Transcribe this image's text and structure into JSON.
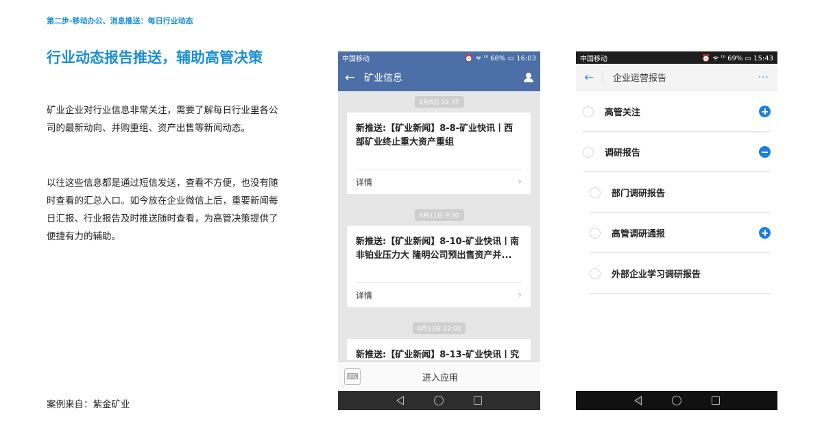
{
  "step_label": "第二步-移动办公、消息推送：每日行业动态",
  "headline": "行业动态报告推送，辅助高管决策",
  "paragraphs": [
    "矿业企业对行业信息非常关注，需要了解每日行业里各公司的最新动向、并购重组、资产出售等新闻动态。",
    "以往这些信息都是通过短信发送，查看不方便，也没有随时查看的汇总入口。如今放在企业微信上后，重要新闻每日汇报、行业报告及时推送随时查看，为高管决策提供了便捷有力的辅助。"
  ],
  "source": "案例来自：紫金矿业",
  "phone_a": {
    "status": {
      "carrier": "中国移动",
      "right": "⏰ ᯤ ᵗˡˡ 68% ▭ 16:03"
    },
    "header_title": "矿业信息",
    "messages": [
      {
        "time": "8月8日 22:37",
        "title": "新推送:【矿业新闻】8-8-矿业快讯丨西部矿业终止重大资产重组",
        "foot": "详情"
      },
      {
        "time": "8月11日 9:30",
        "title": "新推送:【矿业新闻】8-10-矿业快讯丨南非铂业压力大 隆明公司预出售资产并...",
        "foot": "详情"
      },
      {
        "time": "8月13日 22:02",
        "title": "新推送:【矿业新闻】8-13-矿业快讯丨究"
      }
    ],
    "bottom_label": "进入应用"
  },
  "phone_b": {
    "status": {
      "carrier": "中国移动",
      "right": "⏰ ᯤ ᵗˡˡ 69% ▭ 15:43"
    },
    "header_title": "企业运营报告",
    "more_label": "···",
    "items": [
      {
        "label": "高管关注",
        "icon": "plus"
      },
      {
        "label": "调研报告",
        "icon": "minus"
      },
      {
        "label": "部门调研报告",
        "icon": ""
      },
      {
        "label": "高管调研通报",
        "icon": "plus"
      },
      {
        "label": "外部企业学习调研报告",
        "icon": ""
      }
    ]
  },
  "colors": {
    "accent": "#1a8fd6",
    "wechat_header": "#4b6fa6",
    "icon_blue": "#1a7fe0"
  }
}
